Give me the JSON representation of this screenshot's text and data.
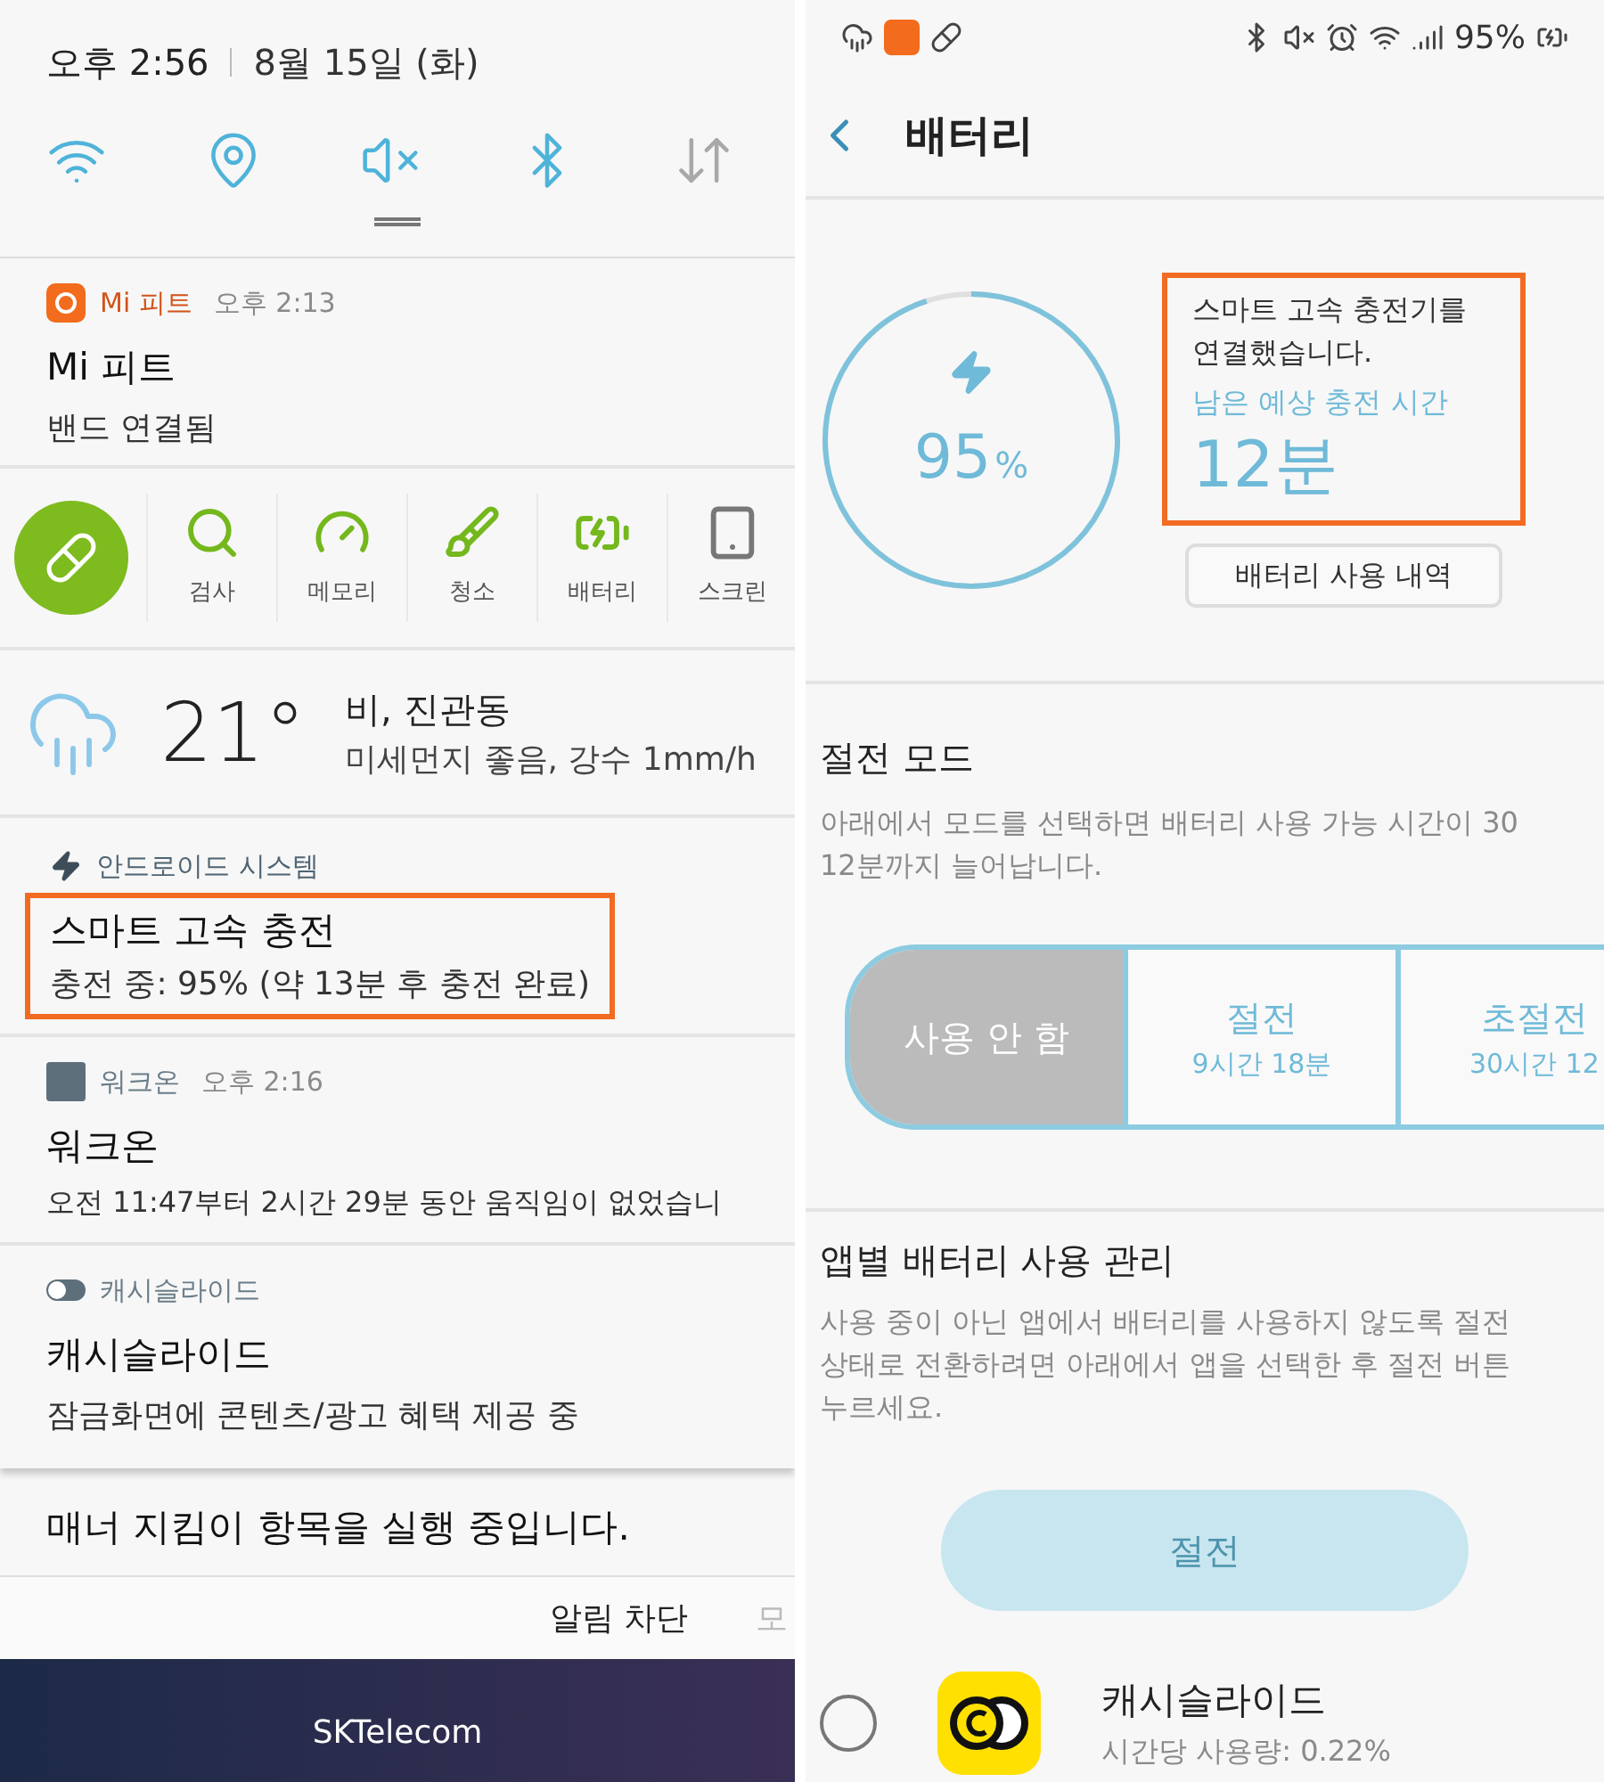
{
  "left": {
    "time": "오후 2:56",
    "date": "8월 15일 (화)",
    "quick_toggles": [
      {
        "kind": "wifi",
        "on": true
      },
      {
        "kind": "location",
        "on": true
      },
      {
        "kind": "sound",
        "on": true
      },
      {
        "kind": "bluetooth",
        "on": true
      },
      {
        "kind": "data",
        "on": false
      }
    ],
    "mi_fit": {
      "app": "Mi 피트",
      "time": "오후 2:13",
      "title": "Mi 피트",
      "text": "밴드 연결됨"
    },
    "shortcuts": [
      {
        "kind": "pill"
      },
      {
        "kind": "search",
        "label": "검사"
      },
      {
        "kind": "gauge",
        "label": "메모리"
      },
      {
        "kind": "brush",
        "label": "청소"
      },
      {
        "kind": "battery",
        "label": "배터리"
      },
      {
        "kind": "tablet",
        "label": "스크린"
      }
    ],
    "weather": {
      "temp": "21°",
      "place": "비, 진관동",
      "detail": "미세먼지 좋음, 강수 1mm/h"
    },
    "system": {
      "app": "안드로이드 시스템",
      "title": "스마트 고속 충전",
      "text": "충전 중: 95% (약 13분 후 충전 완료)"
    },
    "walkon": {
      "app": "워크온",
      "time": "오후 2:16",
      "title": "워크온",
      "text": "오전 11:47부터 2시간 29분 동안 움직임이 없었습니"
    },
    "cashslide": {
      "app": "캐시슬라이드",
      "title": "캐시슬라이드",
      "text": "잠금화면에 콘텐츠/광고 혜택 제공 중"
    },
    "manner": {
      "title": "매너 지킴이 항목을 실행 중입니다."
    },
    "footer_buttons": [
      "알림 차단",
      "모"
    ],
    "carrier": "SKTelecom"
  },
  "right": {
    "status": {
      "battery": "95%"
    },
    "title": "배터리",
    "gauge": {
      "value": "95",
      "unit": "%"
    },
    "info": {
      "message": "스마트 고속 충전기를 연결했습니다.",
      "label": "남은 예상 충전 시간",
      "time": "12분"
    },
    "history_button": "배터리 사용 내역",
    "power_mode": {
      "title": "절전 모드",
      "lines": [
        "아래에서 모드를 선택하면 배터리 사용 가능 시간이 30",
        "12분까지 늘어납니다."
      ],
      "modes": [
        {
          "label": "사용 안 함",
          "selected": true
        },
        {
          "label": "절전",
          "time": "9시간 18분",
          "selected": false
        },
        {
          "label": "초절전",
          "time": "30시간 12",
          "selected": false
        }
      ]
    },
    "app_management": {
      "title": "앱별 배터리 사용 관리",
      "lines": [
        "사용 중이 아닌 앱에서 배터리를 사용하지 않도록 절전",
        "상태로 전환하려면 아래에서 앱을 선택한 후 절전 버튼",
        "누르세요."
      ],
      "button": {
        "label": "절전",
        "disabled": true
      },
      "apps": [
        {
          "name": "캐시슬라이드",
          "usage": "시간당 사용량: 0.22%",
          "selected": false
        }
      ]
    }
  }
}
